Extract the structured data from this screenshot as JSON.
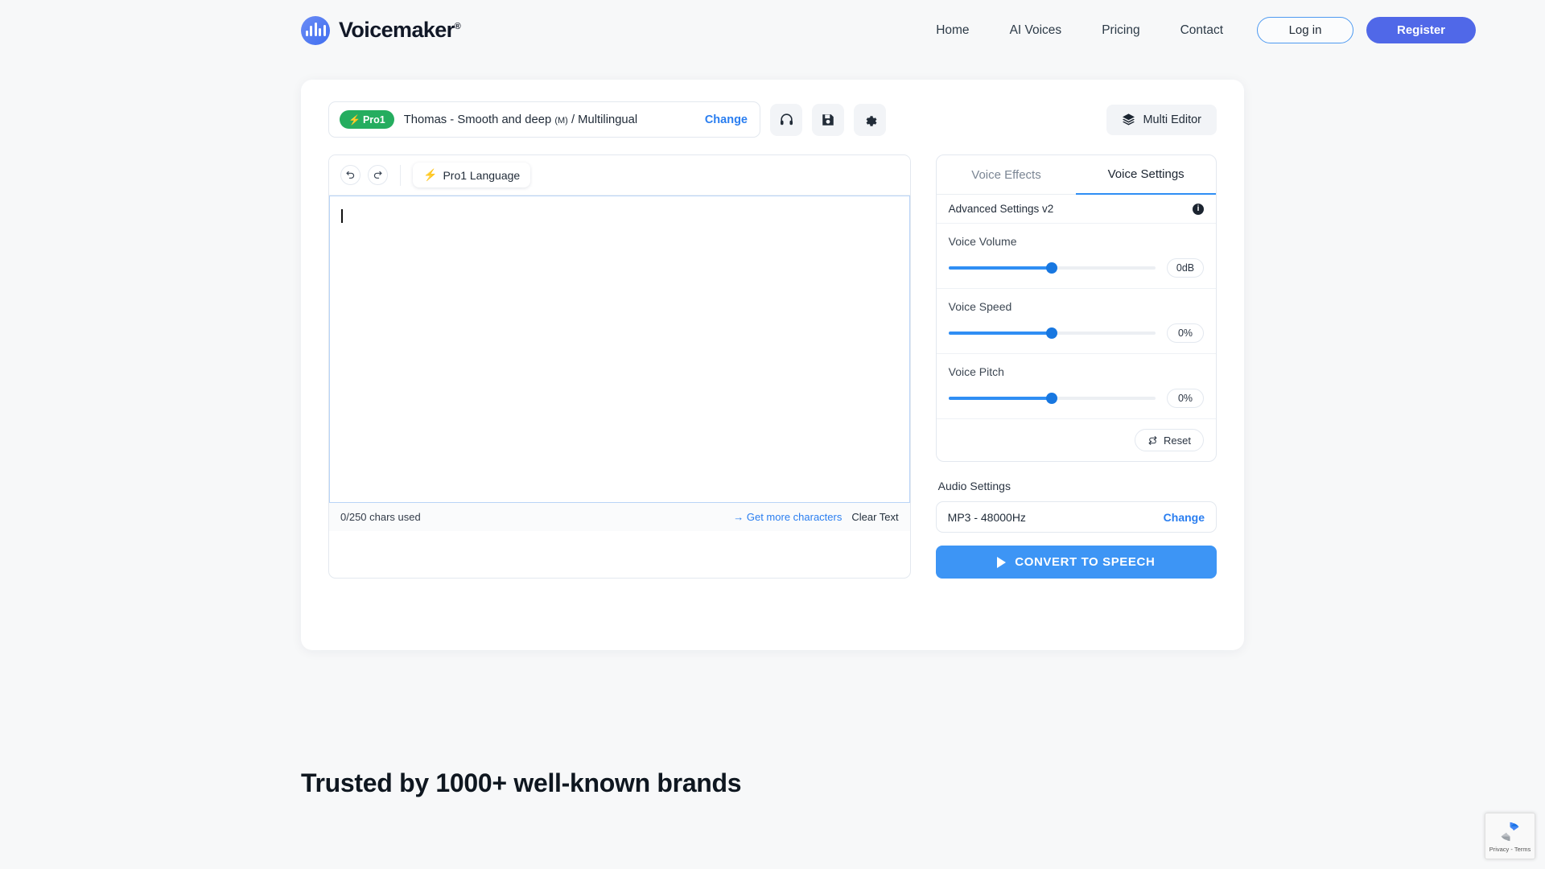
{
  "header": {
    "brand": {
      "name": "Voicemaker",
      "registered": "®",
      "icon": "waveform-logo-icon"
    },
    "nav": [
      {
        "label": "Home"
      },
      {
        "label": "AI Voices"
      },
      {
        "label": "Pricing"
      },
      {
        "label": "Contact"
      }
    ],
    "login_label": "Log in",
    "register_label": "Register",
    "accent_blue": "#5068e8",
    "login_border": "#4e9af1"
  },
  "editor_card": {
    "voice_selector": {
      "badge": "Pro1",
      "badge_color": "#25ad5f",
      "voice_name": "Thomas - Smooth and deep (M) / Multilingual",
      "voice_name_main": "Thomas - Smooth and deep",
      "voice_gender": "(M)",
      "voice_suffix": "/ Multilingual",
      "change_label": "Change"
    },
    "icon_buttons": [
      {
        "name": "headphones-icon"
      },
      {
        "name": "save-icon"
      },
      {
        "name": "gear-icon"
      }
    ],
    "multi_editor_label": "Multi Editor",
    "toolbar": {
      "undo": "undo-icon",
      "redo": "redo-icon",
      "pro_language_label": "Pro1 Language"
    },
    "textarea": {
      "value": "",
      "placeholder": ""
    },
    "footer": {
      "chars_used": "0/250 chars used",
      "get_more_label": "Get more characters",
      "clear_text_label": "Clear Text"
    }
  },
  "settings_panel": {
    "tabs": [
      {
        "label": "Voice Effects",
        "active": false
      },
      {
        "label": "Voice Settings",
        "active": true
      }
    ],
    "advanced_settings_label": "Advanced Settings v2",
    "sliders": [
      {
        "label": "Voice Volume",
        "value": "0dB",
        "percent": 50
      },
      {
        "label": "Voice Speed",
        "value": "0%",
        "percent": 50
      },
      {
        "label": "Voice Pitch",
        "value": "0%",
        "percent": 50
      }
    ],
    "reset_label": "Reset",
    "audio_settings_label": "Audio Settings",
    "audio_format": "MP3 - 48000Hz",
    "audio_change_label": "Change",
    "convert_label": "CONVERT TO SPEECH",
    "convert_color": "#3d95f5",
    "slider_color": "#2f8ef4"
  },
  "trusted_section": {
    "heading": "Trusted by 1000+ well-known brands"
  },
  "recaptcha": {
    "privacy_terms": "Privacy - Terms"
  }
}
